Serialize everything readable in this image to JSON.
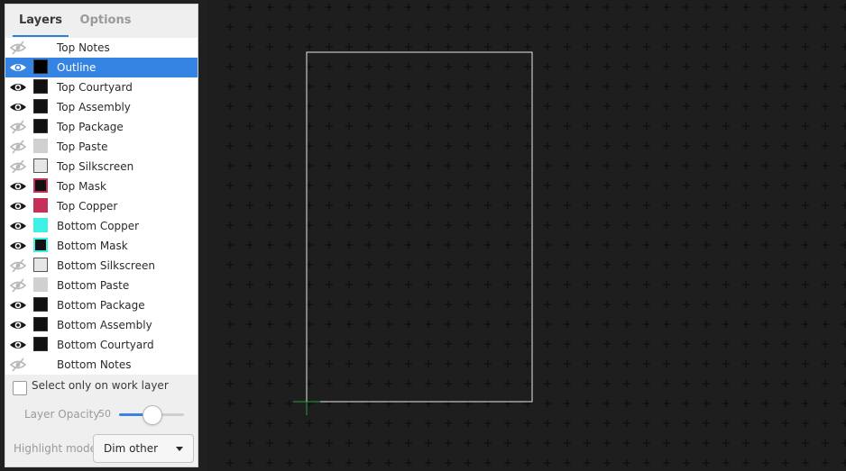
{
  "tabs": {
    "layers": "Layers",
    "options": "Options"
  },
  "layers": [
    {
      "name": "Top Notes",
      "visible": false,
      "color": null,
      "selected": false
    },
    {
      "name": "Outline",
      "visible": true,
      "color": "#000000",
      "selected": true
    },
    {
      "name": "Top Courtyard",
      "visible": true,
      "color": "#111111",
      "selected": false
    },
    {
      "name": "Top Assembly",
      "visible": true,
      "color": "#111111",
      "selected": false
    },
    {
      "name": "Top Package",
      "visible": false,
      "color": "#111111",
      "selected": false
    },
    {
      "name": "Top Paste",
      "visible": false,
      "color": "#d0d0d0",
      "selected": false
    },
    {
      "name": "Top Silkscreen",
      "visible": false,
      "color": "#e6e6e6",
      "selected": false
    },
    {
      "name": "Top Mask",
      "visible": true,
      "color": "#111111",
      "border": "#c43056",
      "selected": false
    },
    {
      "name": "Top Copper",
      "visible": true,
      "color": "#c43056",
      "selected": false
    },
    {
      "name": "Bottom Copper",
      "visible": true,
      "color": "#3ef0e6",
      "selected": false
    },
    {
      "name": "Bottom Mask",
      "visible": true,
      "color": "#111111",
      "border": "#3ef0e6",
      "selected": false
    },
    {
      "name": "Bottom Silkscreen",
      "visible": false,
      "color": "#e6e6e6",
      "selected": false
    },
    {
      "name": "Bottom Paste",
      "visible": false,
      "color": "#d0d0d0",
      "selected": false
    },
    {
      "name": "Bottom Package",
      "visible": true,
      "color": "#111111",
      "selected": false
    },
    {
      "name": "Bottom Assembly",
      "visible": true,
      "color": "#111111",
      "selected": false
    },
    {
      "name": "Bottom Courtyard",
      "visible": true,
      "color": "#111111",
      "selected": false
    },
    {
      "name": "Bottom Notes",
      "visible": false,
      "color": null,
      "selected": false
    }
  ],
  "options": {
    "select_only_work_layer": "Select only on work layer",
    "select_only_work_layer_checked": false,
    "layer_opacity_label": "Layer Opacity",
    "layer_opacity_value": "50",
    "layer_opacity_fraction": 0.5,
    "highlight_mode_label": "Highlight mode",
    "highlight_mode_value": "Dim other"
  },
  "colors": {
    "accent": "#3584e4",
    "canvas_bg": "#1e1e1e",
    "grid_cross": "#0a0a0a",
    "board_outline": "#e8e8e8",
    "origin_marker": "#2f9a3a"
  },
  "icons": {
    "visible": "eye-icon",
    "hidden": "eye-off-icon",
    "dropdown": "chevron-down-icon"
  }
}
